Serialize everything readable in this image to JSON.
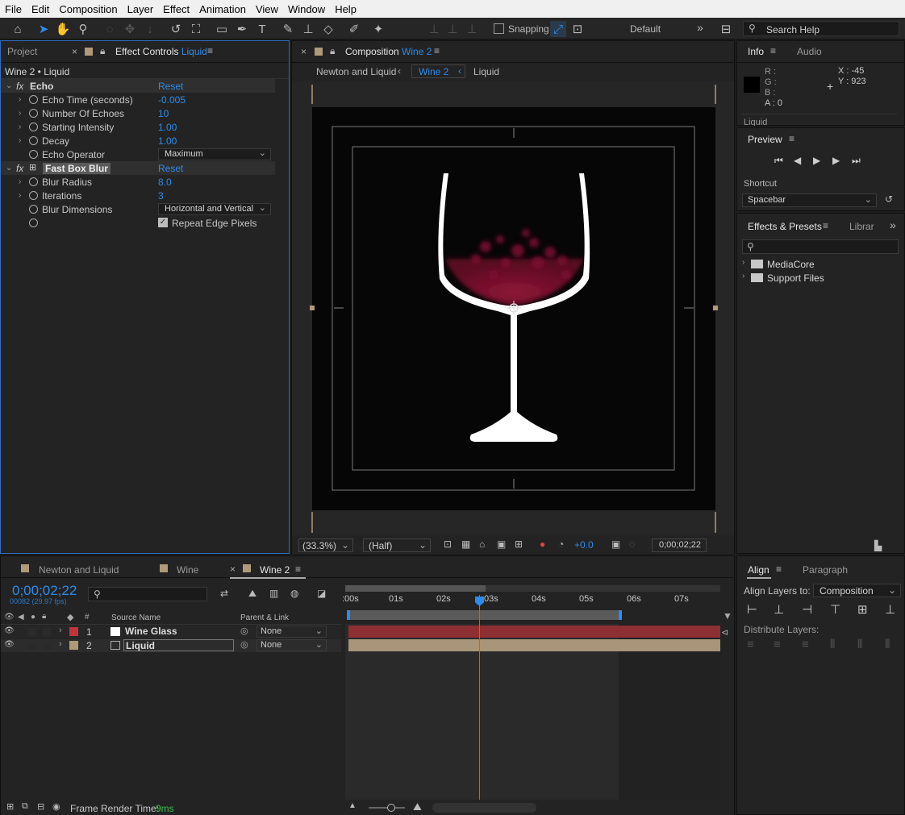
{
  "menu": [
    "File",
    "Edit",
    "Composition",
    "Layer",
    "Effect",
    "Animation",
    "View",
    "Window",
    "Help"
  ],
  "toolbar": {
    "snapping_label": "Snapping",
    "workspace": "Default",
    "search_placeholder": "Search Help"
  },
  "left_panel": {
    "tab_project": "Project",
    "tab_effect_controls": "Effect Controls",
    "tab_effect_layer": "Liquid",
    "subtitle": "Wine 2 • Liquid",
    "echo": {
      "name": "Echo",
      "reset": "Reset",
      "props": [
        {
          "label": "Echo Time (seconds)",
          "value": "-0.005"
        },
        {
          "label": "Number Of Echoes",
          "value": "10"
        },
        {
          "label": "Starting Intensity",
          "value": "1.00"
        },
        {
          "label": "Decay",
          "value": "1.00"
        }
      ],
      "operator_label": "Echo Operator",
      "operator_value": "Maximum"
    },
    "blur": {
      "name": "Fast Box Blur",
      "reset": "Reset",
      "props": [
        {
          "label": "Blur Radius",
          "value": "8.0"
        },
        {
          "label": "Iterations",
          "value": "3"
        }
      ],
      "dimensions_label": "Blur Dimensions",
      "dimensions_value": "Horizontal and Vertical",
      "repeat_edge_label": "Repeat Edge Pixels",
      "repeat_edge_checked": true
    }
  },
  "comp_panel": {
    "tab_label": "Composition",
    "tab_comp": "Wine 2",
    "breadcrumbs": [
      "Newton and Liquid",
      "Wine 2",
      "Liquid"
    ],
    "zoom": "(33.3%)",
    "resolution": "(Half)",
    "exposure": "+0.0",
    "timecode": "0;00;02;22"
  },
  "info_panel": {
    "tab_info": "Info",
    "tab_audio": "Audio",
    "r": "R :",
    "g": "G :",
    "b": "B :",
    "a": "A : 0",
    "x": "X : -45",
    "y": "Y : 923",
    "layer": "Liquid"
  },
  "preview_panel": {
    "title": "Preview",
    "shortcut_label": "Shortcut",
    "shortcut_value": "Spacebar"
  },
  "effects_presets": {
    "tab_label": "Effects & Presets",
    "tab_libraries": "Librar",
    "items": [
      "MediaCore",
      "Support Files"
    ]
  },
  "timeline": {
    "tabs": [
      "Newton and Liquid",
      "Wine",
      "Wine 2"
    ],
    "timecode": "0;00;02;22",
    "frame_info": "00082 (29.97 fps)",
    "col_source": "Source Name",
    "col_parent": "Parent & Link",
    "ruler": [
      ":00s",
      "01s",
      "02s",
      "03s",
      "04s",
      "05s",
      "06s",
      "07s"
    ],
    "layers": [
      {
        "num": "1",
        "name": "Wine Glass",
        "parent": "None",
        "color": "#c0343c"
      },
      {
        "num": "2",
        "name": "Liquid",
        "parent": "None",
        "color": "#b09a7a"
      }
    ],
    "footer_label": "Frame Render Time:",
    "footer_value": "9ms"
  },
  "align_panel": {
    "tab_align": "Align",
    "tab_paragraph": "Paragraph",
    "align_to_label": "Align Layers to:",
    "align_to_value": "Composition",
    "distribute_label": "Distribute Layers:"
  }
}
